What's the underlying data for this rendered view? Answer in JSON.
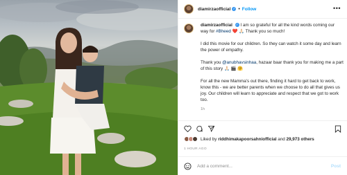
{
  "post": {
    "username": "diamirzaofficial",
    "verified_badge": "✓",
    "follow_label": "Follow",
    "more_icon": "more-horizontal-icon",
    "caption": {
      "author": "diamirzaofficial",
      "text_1a": "I am so grateful for all the kind words coming our way for ",
      "hashtag": "#Bheed",
      "emoji_1": " ❤️ 🙏🏻 ",
      "text_1b": "Thank you so much!",
      "para_2": "I did this movie for our children. So they can watch it some day and learn the power of empathy.",
      "para_3a": "Thank you ",
      "mention": "@anubhavsinhaa",
      "para_3b": ", hazaar baar thank you for making me a part of this story 🙏🏻 🎬 🤗",
      "para_4": "For all the new Mamma's out there, finding it hard to get back to work, know this - we are better parents when we choose to do all that gives us joy. Our children will learn to appreciate and respect that we got to work too.",
      "time": "1h"
    },
    "likes": {
      "prefix": "Liked by ",
      "user": "riddhimakapoorsahniofficial",
      "middle": " and ",
      "count": "29,973 others"
    },
    "posted_ago": "1 HOUR AGO",
    "add_comment_placeholder": "Add a comment...",
    "post_label": "Post"
  },
  "colors": {
    "link_blue": "#0095f6",
    "mention": "#00376b",
    "muted": "#8e8e8e",
    "text": "#262626"
  }
}
